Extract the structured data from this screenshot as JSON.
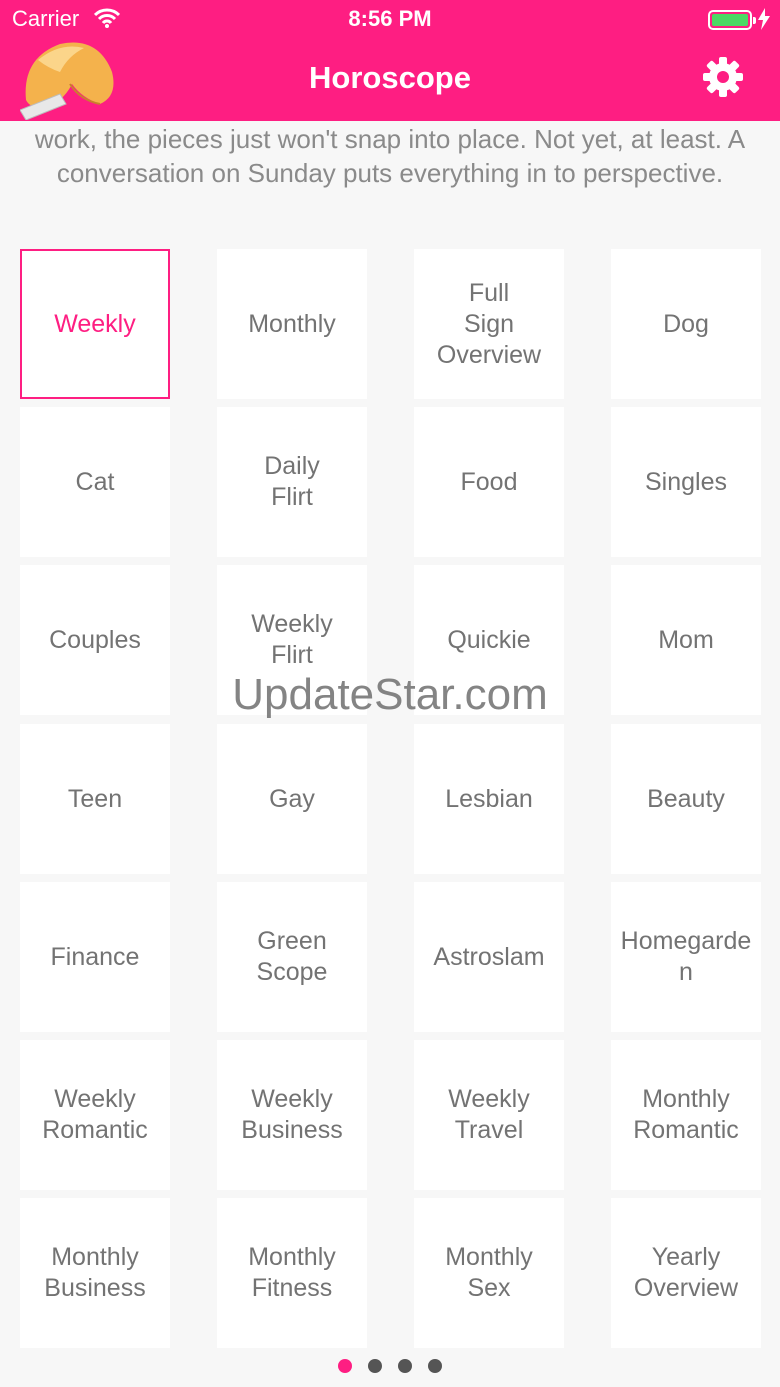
{
  "status_bar": {
    "carrier": "Carrier",
    "time": "8:56 PM",
    "battery_color": "#4cd964"
  },
  "nav": {
    "title": "Horoscope",
    "logo_icon": "fortune-cookie-icon",
    "settings_icon": "gear-icon",
    "bar_color": "#fe1e82"
  },
  "snippet": {
    "text": "work, the pieces just won't snap into place. Not yet, at least. A conversation on Sunday puts everything in to perspective."
  },
  "categories": [
    [
      "Weekly"
    ],
    [
      "Monthly"
    ],
    [
      "Full",
      "Sign",
      "Overview"
    ],
    [
      "Dog"
    ],
    [
      "Cat"
    ],
    [
      "Daily",
      "Flirt"
    ],
    [
      "Food"
    ],
    [
      "Singles"
    ],
    [
      "Couples"
    ],
    [
      "Weekly",
      "Flirt"
    ],
    [
      "Quickie"
    ],
    [
      "Mom"
    ],
    [
      "Teen"
    ],
    [
      "Gay"
    ],
    [
      "Lesbian"
    ],
    [
      "Beauty"
    ],
    [
      "Finance"
    ],
    [
      "Green",
      "Scope"
    ],
    [
      "Astroslam"
    ],
    [
      "Homegarden"
    ],
    [
      "Weekly",
      "Romantic"
    ],
    [
      "Weekly",
      "Business"
    ],
    [
      "Weekly",
      "Travel"
    ],
    [
      "Monthly",
      "Romantic"
    ],
    [
      "Monthly",
      "Business"
    ],
    [
      "Monthly",
      "Fitness"
    ],
    [
      "Monthly",
      "Sex"
    ],
    [
      "Yearly",
      "Overview"
    ]
  ],
  "selected_category": "Weekly",
  "watermark": "UpdateStar.com",
  "pager": {
    "pages": 4,
    "current": 1,
    "active_color": "#fe1e82"
  }
}
